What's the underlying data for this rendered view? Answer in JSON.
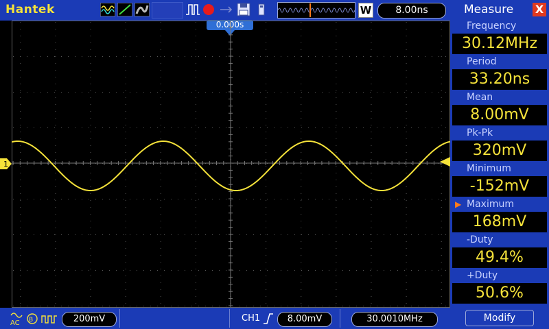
{
  "toolbar": {
    "brand": "Hantek",
    "timebase": "8.00ns",
    "w_button": "W",
    "trigger_time": "0.000s"
  },
  "bottom": {
    "ch1_scale": "200mV",
    "trigger_source": "CH1",
    "trigger_level": "8.00mV",
    "trigger_freq": "30.0010MHz"
  },
  "measure": {
    "title": "Measure",
    "close": "X",
    "items": [
      {
        "label": "Frequency",
        "value": "30.12MHz"
      },
      {
        "label": "Period",
        "value": "33.20ns"
      },
      {
        "label": "Mean",
        "value": "8.00mV"
      },
      {
        "label": "Pk-Pk",
        "value": "320mV"
      },
      {
        "label": "Minimum",
        "value": "-152mV"
      },
      {
        "label": "Maximum",
        "value": "168mV"
      },
      {
        "label": "-Duty",
        "value": "49.4%"
      },
      {
        "label": "+Duty",
        "value": "50.6%"
      }
    ],
    "selected_index": 5,
    "modify": "Modify"
  },
  "channel_marker": "1",
  "colors": {
    "bar": "#1b3bb6",
    "trace": "#f5e23a",
    "accent": "#2f6fd6",
    "close": "#e03a20"
  }
}
